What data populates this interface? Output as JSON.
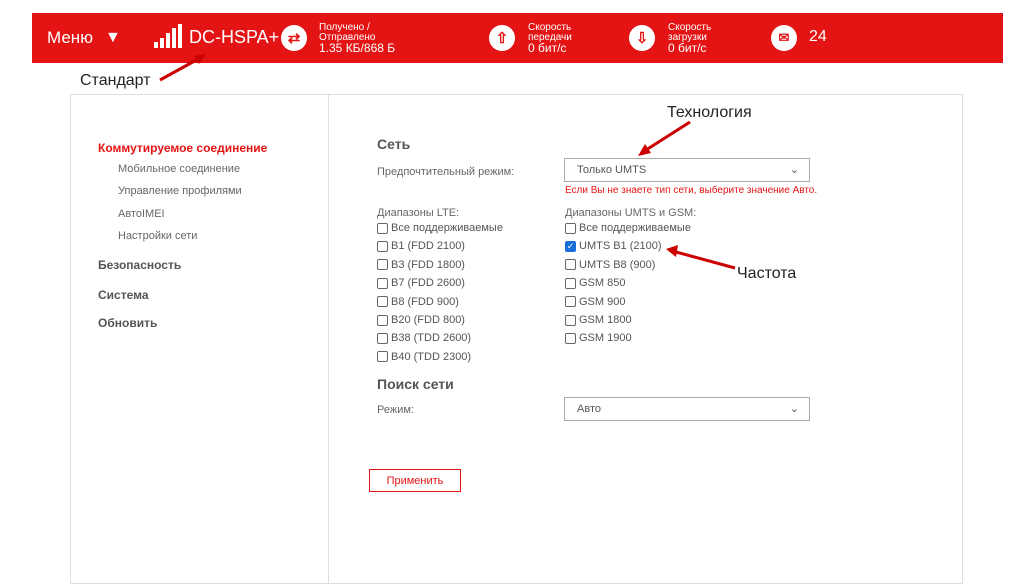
{
  "header": {
    "menu_label": "Меню",
    "network_type": "DC-HSPA+",
    "traffic_label_1": "Получено /",
    "traffic_label_2": "Отправлено",
    "traffic_value": "1.35 КБ/868 Б",
    "upload_label_1": "Скорость",
    "upload_label_2": "передачи",
    "upload_value": "0 бит/с",
    "download_label_1": "Скорость",
    "download_label_2": "загрузки",
    "download_value": "0 бит/с",
    "messages_count": "24",
    "accent_color": "#e41414"
  },
  "annotations": {
    "standard": "Стандарт",
    "technology": "Технология",
    "frequency": "Частота"
  },
  "sidebar": {
    "items": [
      {
        "label": "Коммутируемое соединение"
      },
      {
        "label": "Мобильное соединение"
      },
      {
        "label": "Управление профилями"
      },
      {
        "label": "AвтоIMEI"
      },
      {
        "label": "Настройки сети"
      },
      {
        "label": "Безопасность"
      },
      {
        "label": "Система"
      },
      {
        "label": "Обновить"
      }
    ]
  },
  "network": {
    "title": "Сеть",
    "preferred_mode_label": "Предпочтительный режим:",
    "preferred_mode_value": "Только UMTS",
    "warning": "Если Вы не знаете тип сети, выберите значение Авто.",
    "lte_title": "Диапазоны LTE:",
    "lte_bands": [
      {
        "label": "Все поддерживаемые",
        "checked": false
      },
      {
        "label": "B1 (FDD 2100)",
        "checked": false
      },
      {
        "label": "B3 (FDD 1800)",
        "checked": false
      },
      {
        "label": "B7 (FDD 2600)",
        "checked": false
      },
      {
        "label": "B8 (FDD 900)",
        "checked": false
      },
      {
        "label": "B20 (FDD 800)",
        "checked": false
      },
      {
        "label": "B38 (TDD 2600)",
        "checked": false
      },
      {
        "label": "B40 (TDD 2300)",
        "checked": false
      }
    ],
    "umts_title": "Диапазоны UMTS и GSM:",
    "umts_bands": [
      {
        "label": "Все поддерживаемые",
        "checked": false
      },
      {
        "label": "UMTS B1 (2100)",
        "checked": true
      },
      {
        "label": "UMTS B8 (900)",
        "checked": false
      },
      {
        "label": "GSM 850",
        "checked": false
      },
      {
        "label": "GSM 900",
        "checked": false
      },
      {
        "label": "GSM 1800",
        "checked": false
      },
      {
        "label": "GSM 1900",
        "checked": false
      }
    ]
  },
  "search": {
    "title": "Поиск сети",
    "mode_label": "Режим:",
    "mode_value": "Авто"
  },
  "apply_label": "Применить"
}
